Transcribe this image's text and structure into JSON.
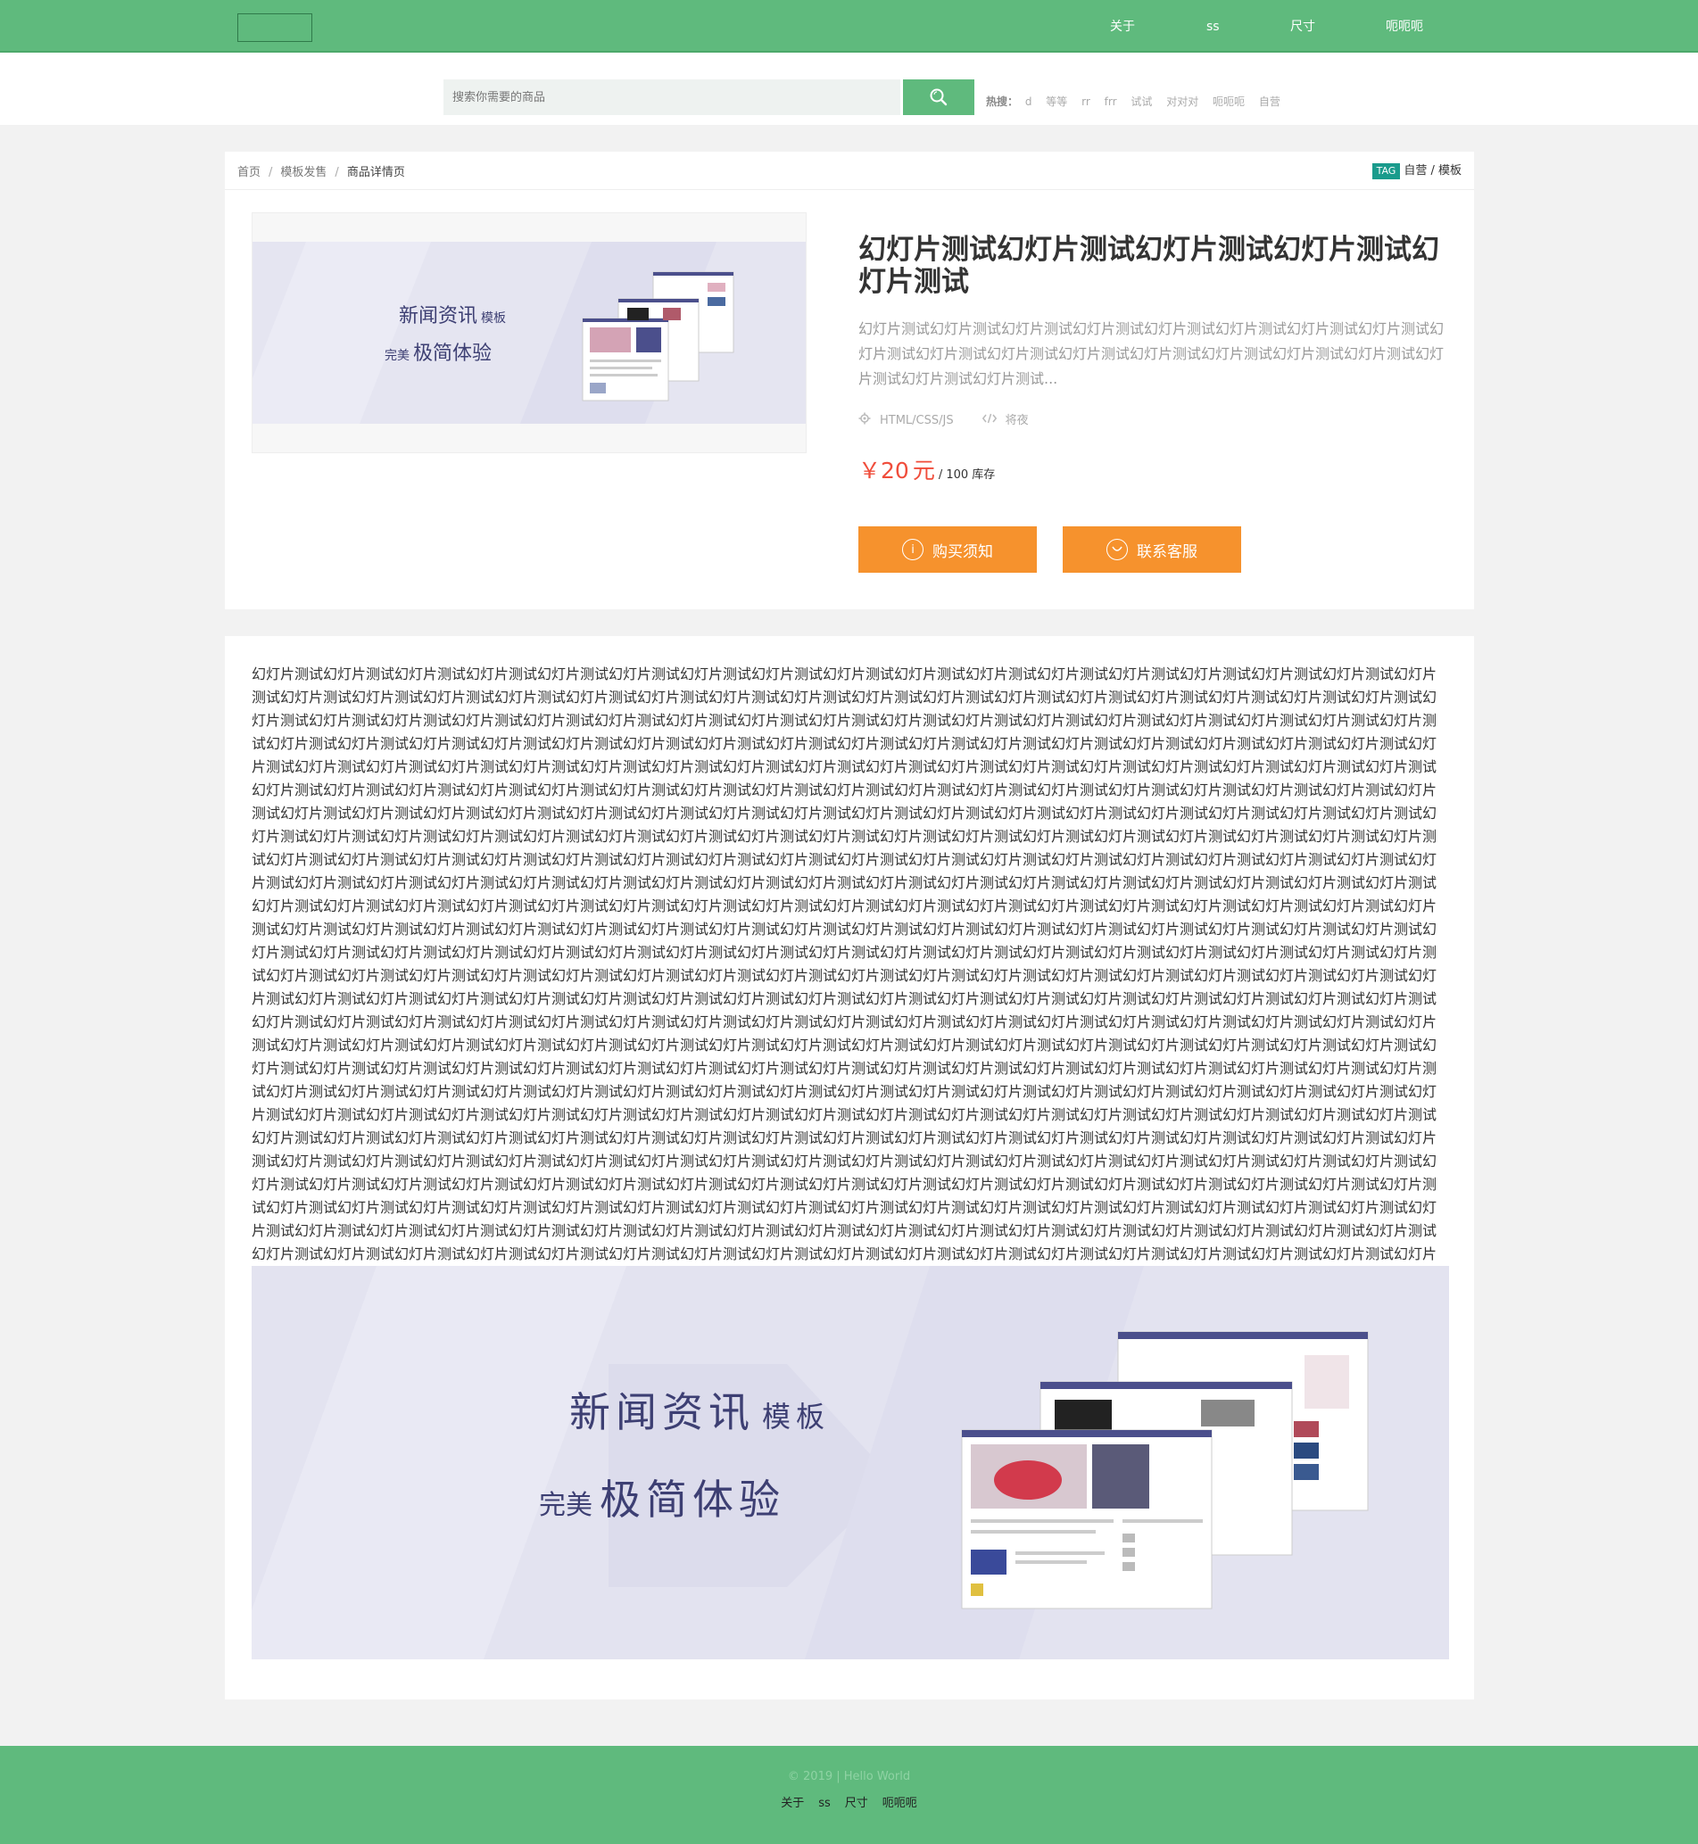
{
  "nav": {
    "items": [
      "关于",
      "ss",
      "尺寸",
      "呃呃呃"
    ]
  },
  "search": {
    "placeholder": "搜索你需要的商品",
    "hot_label": "热搜：",
    "hot_words": [
      "d",
      "等等",
      "rr",
      "frr",
      "试试",
      "对对对",
      "呃呃呃",
      "自营"
    ]
  },
  "breadcrumb": {
    "items": [
      "首页",
      "模板发售",
      "商品详情页"
    ]
  },
  "tags": {
    "badge": "TAG",
    "values": "自营 / 模板"
  },
  "product": {
    "title": "幻灯片测试幻灯片测试幻灯片测试幻灯片测试幻灯片测试",
    "summary": "幻灯片测试幻灯片测试幻灯片测试幻灯片测试幻灯片测试幻灯片测试幻灯片测试幻灯片测试幻灯片测试幻灯片测试幻灯片测试幻灯片测试幻灯片测试幻灯片测试幻灯片测试幻灯片测试幻灯片测试幻灯片测试幻灯片测试...",
    "tech": "HTML/CSS/JS",
    "author": "将夜",
    "price_symbol": "￥",
    "price": "20",
    "price_unit": "元",
    "stock": "/ 100 库存",
    "buy_notice_label": "购买须知",
    "contact_label": "联系客服"
  },
  "banner": {
    "title_big": "新闻资讯",
    "title_small": "模板",
    "subtitle_small": "完美",
    "subtitle_big": "极简体验"
  },
  "description": {
    "body": "幻灯片测试幻灯片测试幻灯片测试幻灯片测试幻灯片测试幻灯片测试幻灯片测试幻灯片测试幻灯片测试幻灯片测试幻灯片测试幻灯片测试幻灯片测试幻灯片测试幻灯片测试幻灯片测试幻灯片测试幻灯片测试幻灯片测试幻灯片测试幻灯片测试幻灯片测试幻灯片测试幻灯片测试幻灯片测试幻灯片测试幻灯片测试幻灯片测试幻灯片测试幻灯片测试幻灯片测试幻灯片测试幻灯片测试幻灯片测试幻灯片测试幻灯片测试幻灯片测试幻灯片测试幻灯片测试幻灯片测试幻灯片测试幻灯片测试幻灯片测试幻灯片测试幻灯片测试幻灯片测试幻灯片测试幻灯片测试幻灯片测试幻灯片测试幻灯片测试幻灯片测试幻灯片测试幻灯片测试幻灯片测试幻灯片测试幻灯片测试幻灯片测试幻灯片测试幻灯片测试幻灯片测试幻灯片测试幻灯片测试幻灯片测试幻灯片测试幻灯片测试幻灯片测试幻灯片测试幻灯片测试幻灯片测试幻灯片测试幻灯片测试幻灯片测试幻灯片测试幻灯片测试幻灯片测试幻灯片测试幻灯片测试幻灯片测试幻灯片测试幻灯片测试幻灯片测试幻灯片测试幻灯片测试幻灯片测试幻灯片测试幻灯片测试幻灯片测试幻灯片测试幻灯片测试幻灯片测试幻灯片测试幻灯片测试幻灯片测试幻灯片测试幻灯片测试幻灯片测试幻灯片测试幻灯片测试幻灯片测试幻灯片测试幻灯片测试幻灯片测试幻灯片测试幻灯片测试幻灯片测试幻灯片测试幻灯片测试幻灯片测试幻灯片测试幻灯片测试幻灯片测试幻灯片测试幻灯片测试幻灯片测试幻灯片测试幻灯片测试幻灯片测试幻灯片测试幻灯片测试幻灯片测试幻灯片测试幻灯片测试幻灯片测试幻灯片测试幻灯片测试幻灯片测试幻灯片测试幻灯片测试幻灯片测试幻灯片测试幻灯片测试幻灯片测试幻灯片测试幻灯片测试幻灯片测试幻灯片测试幻灯片测试幻灯片测试幻灯片测试幻灯片测试幻灯片测试幻灯片测试幻灯片测试幻灯片测试幻灯片测试幻灯片测试幻灯片测试幻灯片测试幻灯片测试幻灯片测试幻灯片测试幻灯片测试幻灯片测试幻灯片测试幻灯片测试幻灯片测试幻灯片测试幻灯片测试幻灯片测试幻灯片测试幻灯片测试幻灯片测试幻灯片测试幻灯片测试幻灯片测试幻灯片测试幻灯片测试幻灯片测试幻灯片测试幻灯片测试幻灯片测试幻灯片测试幻灯片测试幻灯片测试幻灯片测试幻灯片测试幻灯片测试幻灯片测试幻灯片测试幻灯片测试幻灯片测试幻灯片测试幻灯片测试幻灯片测试幻灯片测试幻灯片测试幻灯片测试幻灯片测试幻灯片测试幻灯片测试幻灯片测试幻灯片测试幻灯片测试幻灯片测试幻灯片测试幻灯片测试幻灯片测试幻灯片测试幻灯片测试幻灯片测试幻灯片测试幻灯片测试幻灯片测试幻灯片测试幻灯片测试幻灯片测试幻灯片测试幻灯片测试幻灯片测试幻灯片测试幻灯片测试幻灯片测试幻灯片测试幻灯片测试幻灯片测试幻灯片测试幻灯片测试幻灯片测试幻灯片测试幻灯片测试幻灯片测试幻灯片测试幻灯片测试幻灯片测试幻灯片测试幻灯片测试幻灯片测试幻灯片测试幻灯片测试幻灯片测试幻灯片测试幻灯片测试幻灯片测试幻灯片测试幻灯片测试幻灯片测试幻灯片测试幻灯片测试幻灯片测试幻灯片测试幻灯片测试幻灯片测试幻灯片测试幻灯片测试幻灯片测试幻灯片测试幻灯片测试幻灯片测试幻灯片测试幻灯片测试幻灯片测试幻灯片测试幻灯片测试幻灯片测试幻灯片测试幻灯片测试幻灯片测试幻灯片测试幻灯片测试幻灯片测试幻灯片测试幻灯片测试幻灯片测试幻灯片测试幻灯片测试幻灯片测试幻灯片测试幻灯片测试幻灯片测试幻灯片测试幻灯片测试幻灯片测试幻灯片测试幻灯片测试幻灯片测试幻灯片测试幻灯片测试幻灯片测试幻灯片测试幻灯片测试幻灯片测试幻灯片测试幻灯片测试幻灯片测试幻灯片测试幻灯片测试幻灯片测试幻灯片测试幻灯片测试幻灯片测试幻灯片测试幻灯片测试幻灯片测试幻灯片测试幻灯片测试幻灯片测试幻灯片测试幻灯片测试幻灯片测试幻灯片测试幻灯片测试幻灯片测试幻灯片测试幻灯片测试幻灯片测试幻灯片测试幻灯片测试幻灯片测试幻灯片测试幻灯片测试幻灯片测试幻灯片测试幻灯片测试幻灯片测试幻灯片测试幻灯片测试幻灯片测试幻灯片测试幻灯片测试幻灯片测试幻灯片测试幻灯片测试幻灯片测试幻灯片测试幻灯片测试幻灯片测试幻灯片测试幻灯片测试幻灯片测试幻灯片测试幻灯片测试幻灯片测试幻灯片测试幻灯片测试幻灯片测试幻灯片测试幻灯片测试幻灯片测试幻灯片测试幻灯片测试幻灯片测试幻灯片测试幻灯片测试幻灯片测试幻灯片测试幻灯片测试幻灯片测试幻灯片测试幻灯片测试幻灯片测试幻灯片测试幻灯片测试幻灯片测试幻灯片测试幻灯片测试幻灯片测试幻灯片测试幻灯片测试幻灯片测试幻灯片测试幻灯片测试幻灯片测试幻灯片测试幻灯片测试幻灯片测试幻灯片测试幻灯片测试幻灯片测试幻灯片测试幻灯片测试幻灯片测试幻灯片测试幻灯片测试幻灯片测试幻灯片测试幻灯片测试幻灯片测试幻灯片测试幻灯片测试幻灯片测试幻灯片测试幻灯片测试幻灯片测试幻灯片测试幻灯片测试幻灯片测试幻灯片测试幻灯片测试幻灯片测试幻灯片测试幻灯片测试幻灯片测试幻灯片测试幻灯片测试幻灯片测试幻灯片测试幻灯片测试幻灯片测试幻灯片测试幻灯片测试幻灯片测试幻灯片测试幻灯片测试幻灯片测试幻灯片测试幻灯片测试幻灯片测试幻灯片测试幻灯片测试幻灯片测试幻灯片测试幻灯片测试幻灯片测试幻灯片测试幻灯片测试幻灯片测试幻灯片测试幻灯片测试幻灯片测试幻灯片测试幻灯片测试幻灯片测试幻灯片测试幻灯片测试幻灯片测试幻灯片测试幻灯片测试幻灯片测试幻灯片测试幻灯片测试幻灯片测试幻灯片测试幻灯片测试幻灯片测试幻灯片测试幻灯片测试幻灯片测试幻灯片测试幻灯片测试幻灯片测试幻灯片测试幻灯片测试幻灯片测试幻灯片测试幻灯片测试幻灯片测试幻灯片测试幻灯片测试幻灯片测试幻灯片测试幻灯片测试幻灯片测试幻灯片测试幻灯片测试幻灯片测试幻灯片测试幻灯片测试幻灯片测试幻灯片测试幻灯片测试幻灯片测试幻灯片测试幻灯片测试幻灯片测试幻灯片测试幻灯片测试幻灯片测试幻灯片测试幻灯片测试幻灯片测试幻灯片测试幻灯片测试幻灯片测试幻灯片测试幻灯片测试幻灯片测试幻灯片测试幻灯片测试幻灯片测试幻灯片测试幻灯片测试幻灯片测试幻灯片测试幻灯片测试幻灯片测试幻灯片测试幻灯片测试幻灯片测试幻灯片测试幻灯片测试幻灯片测试幻灯片测试幻灯片测试幻灯片测试幻灯片测试幻灯片测试幻灯片测试幻灯片测试幻灯片测试幻灯片测试幻灯片测试幻灯片测试幻灯片测试幻灯片测试幻灯片测试幻灯片测试幻灯片测试幻灯片测试幻灯片测试"
  },
  "footer": {
    "copyright": "© 2019 | Hello World",
    "links": [
      "关于",
      "ss",
      "尺寸",
      "呃呃呃"
    ]
  },
  "colors": {
    "brand_green": "#5fba7d",
    "accent_orange": "#f6922d",
    "price_red": "#f04d3b",
    "tag_teal": "#1a9b8c"
  }
}
